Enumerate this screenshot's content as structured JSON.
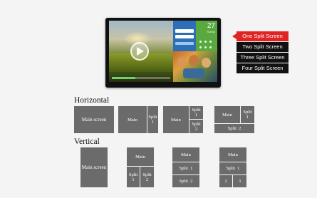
{
  "tv": {
    "weather_temp": "27",
    "weather_sub": "Sunny"
  },
  "split_menu": {
    "items": [
      {
        "label": "One Split Screen",
        "active": true
      },
      {
        "label": "Two Split Screen",
        "active": false
      },
      {
        "label": "Three Split Screen",
        "active": false
      },
      {
        "label": "Four Split Screen",
        "active": false
      }
    ]
  },
  "horizontal": {
    "heading": "Horizontal",
    "layouts": [
      {
        "main": "Main screen"
      },
      {
        "main": "Main",
        "split1": "Split\n1"
      },
      {
        "main": "Main",
        "split1": "Split\n1",
        "split2": "Split\n2"
      },
      {
        "main": "Main",
        "split1": "Split\n1",
        "split2": "Split  2"
      }
    ]
  },
  "vertical": {
    "heading": "Vertical",
    "layouts": [
      {
        "main": "Main screen"
      },
      {
        "main": "Main",
        "split1": "Split\n1",
        "split2": "Split\n2"
      },
      {
        "main": "Main",
        "split1": "Split  1",
        "split2": "Split  2"
      },
      {
        "main": "Main",
        "split1": "Split  1",
        "split2": "2",
        "split3": "3"
      }
    ]
  }
}
